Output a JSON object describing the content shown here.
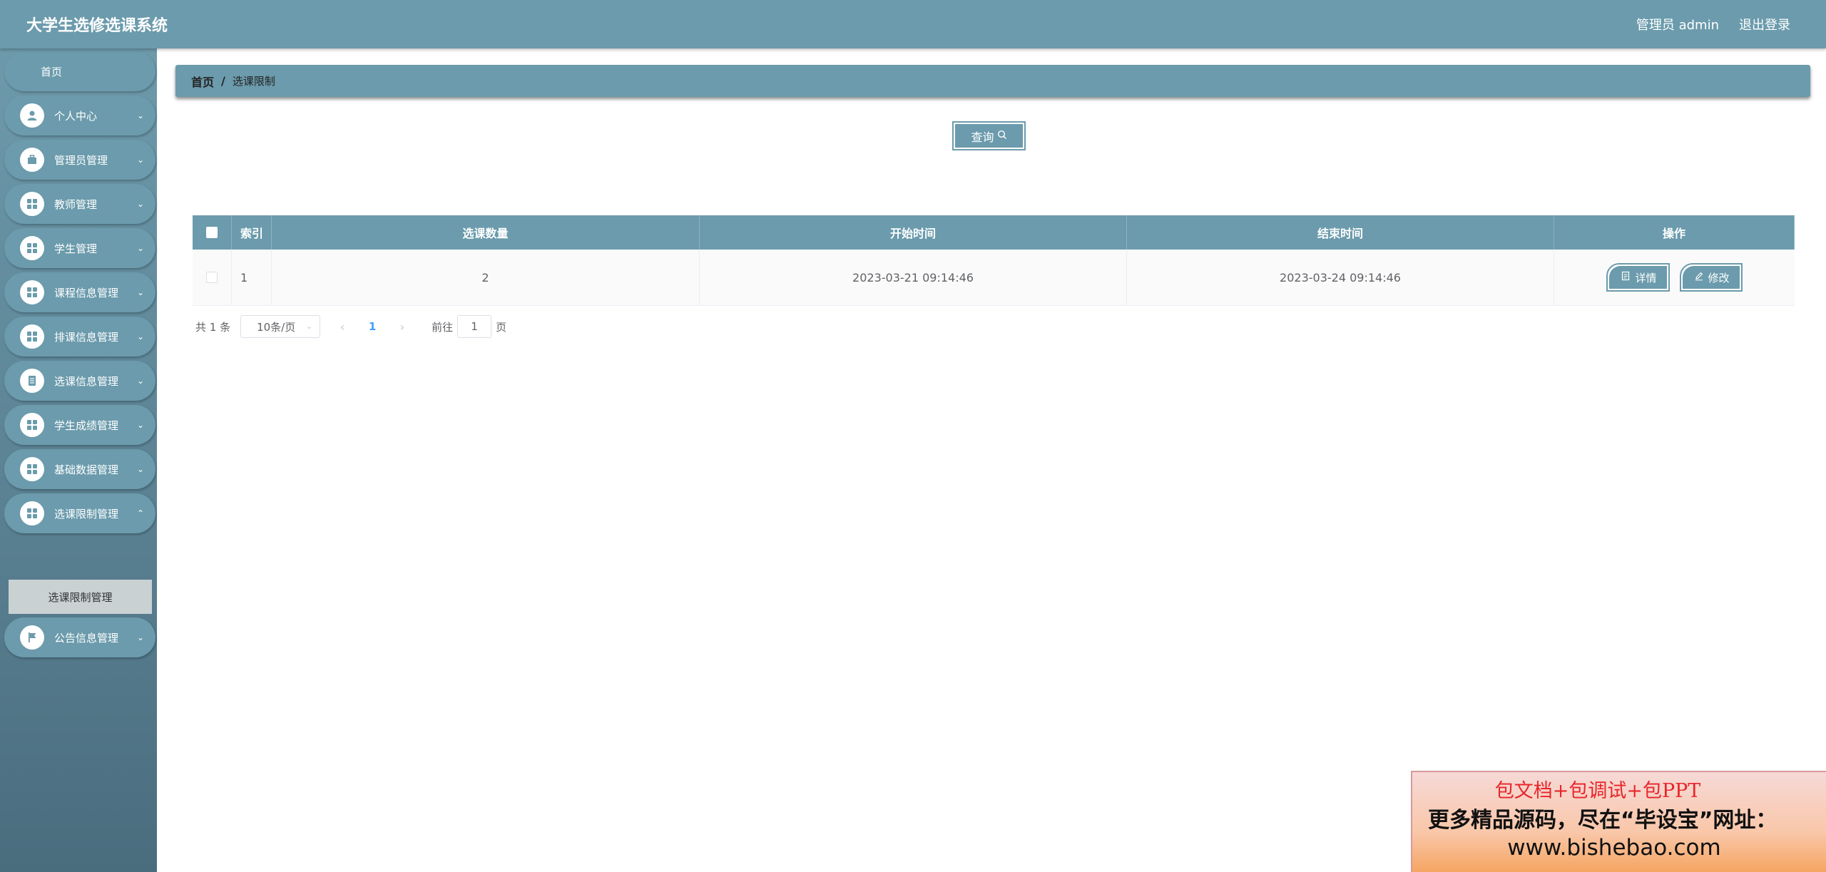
{
  "header": {
    "app_title": "大学生选修选课系统",
    "user_label": "管理员 admin",
    "logout_label": "退出登录"
  },
  "sidebar": {
    "home_label": "首页",
    "items": [
      {
        "label": "个人中心",
        "icon": "user-icon"
      },
      {
        "label": "管理员管理",
        "icon": "briefcase-icon"
      },
      {
        "label": "教师管理",
        "icon": "grid-icon"
      },
      {
        "label": "学生管理",
        "icon": "grid-icon"
      },
      {
        "label": "课程信息管理",
        "icon": "grid-icon"
      },
      {
        "label": "排课信息管理",
        "icon": "grid-icon"
      },
      {
        "label": "选课信息管理",
        "icon": "document-icon"
      },
      {
        "label": "学生成绩管理",
        "icon": "grid-icon"
      },
      {
        "label": "基础数据管理",
        "icon": "grid-icon"
      },
      {
        "label": "选课限制管理",
        "icon": "grid-icon"
      },
      {
        "label": "公告信息管理",
        "icon": "flag-icon"
      }
    ],
    "active_subitem": "选课限制管理"
  },
  "breadcrumb": {
    "home": "首页",
    "separator": "/",
    "current": "选课限制"
  },
  "toolbar": {
    "query_label": "查询"
  },
  "table": {
    "headers": {
      "index": "索引",
      "count": "选课数量",
      "start": "开始时间",
      "end": "结束时间",
      "ops": "操作"
    },
    "rows": [
      {
        "index": "1",
        "count": "2",
        "start": "2023-03-21 09:14:46",
        "end": "2023-03-24 09:14:46"
      }
    ],
    "detail_label": "详情",
    "edit_label": "修改"
  },
  "pagination": {
    "total": "共 1 条",
    "page_size": "10条/页",
    "current_page": "1",
    "goto_prefix": "前往",
    "goto_value": "1",
    "goto_suffix": "页"
  },
  "ad": {
    "line1": "包文档+包调试+包PPT",
    "line2": "更多精品源码，尽在“毕设宝”网址：",
    "line3": "www.bishebao.com"
  },
  "colors": {
    "primary": "#6b9bac",
    "sidebar_bottom": "#4a6d7e",
    "page_active": "#409eff"
  }
}
